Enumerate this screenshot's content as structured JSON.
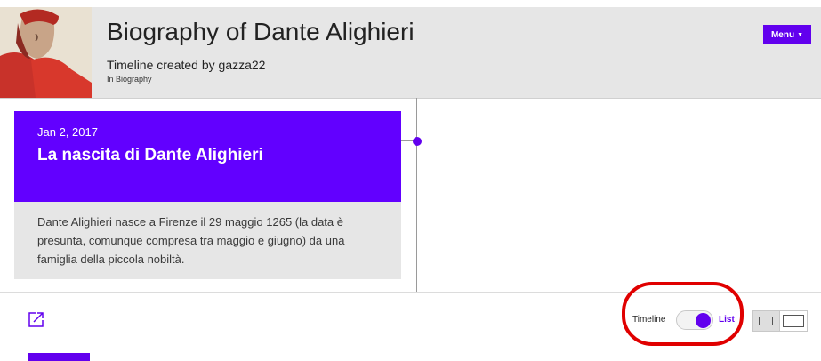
{
  "header": {
    "title": "Biography of Dante Alighieri",
    "subtitle": "Timeline created by gazza22",
    "category": "In Biography",
    "menu_label": "Menu",
    "portrait_icon": "portrait-image"
  },
  "event": {
    "date": "Jan 2, 2017",
    "title": "La nascita di Dante Alighieri",
    "description": "Dante Alighieri nasce a Firenze il 29 maggio 1265 (la data è presunta, comunque compresa tra maggio e giugno) da una famiglia della piccola nobiltà."
  },
  "toolbar": {
    "share_icon": "share-icon",
    "timeline_label": "Timeline",
    "list_label": "List",
    "toggle_state": "list"
  },
  "colors": {
    "accent": "#6200ee",
    "card_head": "#6200ff",
    "annotation": "#e00000"
  }
}
